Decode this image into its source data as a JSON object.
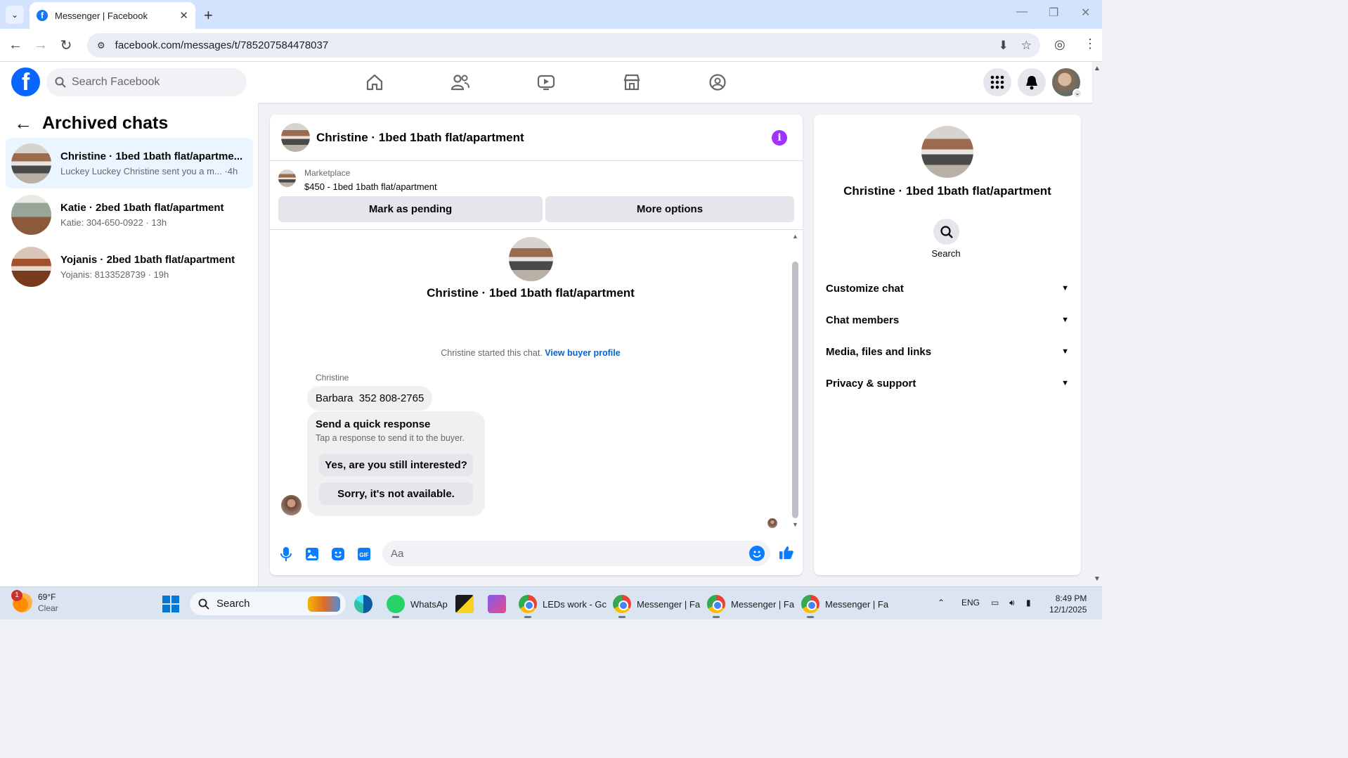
{
  "browser": {
    "tab_title": "Messenger | Facebook",
    "url": "facebook.com/messages/t/785207584478037"
  },
  "fb_header": {
    "search_placeholder": "Search Facebook"
  },
  "sidebar": {
    "title": "Archived chats",
    "chats": [
      {
        "name": "Christine · 1bed 1bath flat/apartme...",
        "preview": "Luckey Luckey Christine sent you a m... ·4h"
      },
      {
        "name": "Katie · 2bed 1bath flat/apartment",
        "preview": "Katie: 304-650-0922 · 13h"
      },
      {
        "name": "Yojanis · 2bed 1bath flat/apartment",
        "preview": "Yojanis: 8133528739 · 19h"
      }
    ]
  },
  "chat": {
    "title": "Christine · 1bed 1bath flat/apartment",
    "marketplace_label": "Marketplace",
    "listing": "$450 - 1bed 1bath flat/apartment",
    "mark_pending_label": "Mark as pending",
    "more_options_label": "More options",
    "thread_title": "Christine · 1bed 1bath flat/apartment",
    "started_text": "Christine started this chat.",
    "view_buyer_label": "View buyer profile",
    "sender": "Christine",
    "message": "Barbara  352 808-2765",
    "quick_response_title": "Send a quick response",
    "quick_response_sub": "Tap a response to send it to the buyer.",
    "quick_responses": [
      "Yes, are you still interested?",
      "Sorry, it's not available."
    ],
    "composer_placeholder": "Aa"
  },
  "info_panel": {
    "name": "Christine · 1bed 1bath flat/apartment",
    "search_label": "Search",
    "sections": [
      "Customize chat",
      "Chat members",
      "Media, files and links",
      "Privacy & support"
    ]
  },
  "taskbar": {
    "temperature": "69°F",
    "condition": "Clear",
    "weather_badge": "1",
    "search_label": "Search",
    "apps": [
      {
        "label": "WhatsAp"
      },
      {
        "label": "LEDs work - Gc"
      },
      {
        "label": "Messenger | Fa"
      },
      {
        "label": "Messenger | Fa"
      },
      {
        "label": "Messenger | Fa"
      }
    ],
    "language": "ENG",
    "time": "8:49 PM",
    "date": "12/1/2025"
  },
  "colors": {
    "fb_blue": "#0866ff",
    "link_blue": "#0064d1",
    "info_purple": "#a033ff",
    "messenger_blue": "#0a7cff"
  }
}
